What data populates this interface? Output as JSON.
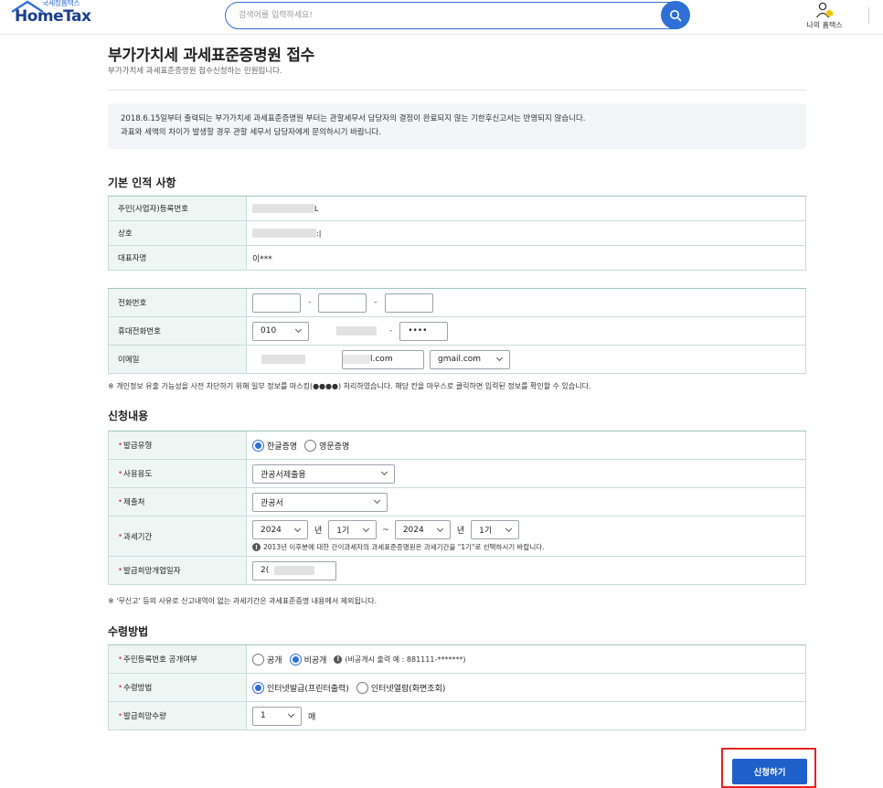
{
  "header": {
    "logo_small": "국세청홈택스",
    "logo_main": "HomeTax",
    "search_placeholder": "검색어를 입력하세요!",
    "my_hometax": "나의 홈택스"
  },
  "page": {
    "title": "부가가치세 과세표준증명원 접수",
    "subtitle": "부가가치세 과세표준증명원 접수신청하는 민원입니다.",
    "notice_line1": "2018.6.15일부터 출력되는 부가가치세 과세표준증명원 부터는 관할세무서 담당자의 결정이 완료되지 않는 기한후신고서는 반영되지 않습니다.",
    "notice_line2": "과표와 세액의 차이가 발생할 경우 관할 세무서 담당자에게 문의하시기 바랍니다."
  },
  "basic": {
    "section_title": "기본 인적 사항",
    "reg_no_label": "주민(사업자)등록번호",
    "reg_no_tail": "L",
    "company_label": "상호",
    "company_tail": ":|",
    "rep_label": "대표자명",
    "rep_value": "이***",
    "phone_label": "전화번호",
    "mobile_label": "휴대전화번호",
    "mobile_prefix": "010",
    "mobile_last": "••••",
    "email_label": "이메일",
    "email_domain_tail": "l.com",
    "email_domain_select": "gmail.com",
    "privacy_note": "※ 개인정보 유출 가능성을 사전 차단하기 위해 일부 정보를 마스킹(●●●●) 처리하였습니다. 해당 칸을 마우스로 클릭하면 입력된 정보를 확인할 수 있습니다."
  },
  "apply": {
    "section_title": "신청내용",
    "type_label": "발급유형",
    "type_korean": "한글증명",
    "type_english": "영문증명",
    "usage_label": "사용용도",
    "usage_value": "관공서제출용",
    "submit_to_label": "제출처",
    "submit_to_value": "관공서",
    "period_label": "과세기간",
    "period_from_year": "2024",
    "period_from_term": "1기",
    "period_to_year": "2024",
    "period_to_term": "1기",
    "year_unit": "년",
    "tilde": "~",
    "period_note": "2013년 이후분에 대한 간이과세자의 과세표준증명원은 과세기간을 \"1기\"로 선택하시기 바랍니다.",
    "open_date_label": "발급희망개업일자",
    "open_date_value": "2(",
    "footnote": "※ '무신고' 등의 사유로 신고내역이 없는 과세기간은 과세표준증명 내용에서 제외됩니다."
  },
  "receive": {
    "section_title": "수령방법",
    "disclose_label": "주민등록번호 공개여부",
    "disclose_open": "공개",
    "disclose_closed": "비공개",
    "disclose_note": "(비공개시 출력 예 : 881111-*******)",
    "method_label": "수령방법",
    "method_print": "인터넷발급(프린터출력)",
    "method_view": "인터넷열람(화면조회)",
    "qty_label": "발급희망수량",
    "qty_value": "1",
    "qty_unit": "매"
  },
  "actions": {
    "submit_label": "신청하기"
  },
  "colors": {
    "brand_blue": "#2f6fd6",
    "button_blue": "#1f5fc9",
    "table_header_bg": "#eef6f4",
    "required_red": "#e0483d",
    "highlight_red": "#e52420"
  }
}
